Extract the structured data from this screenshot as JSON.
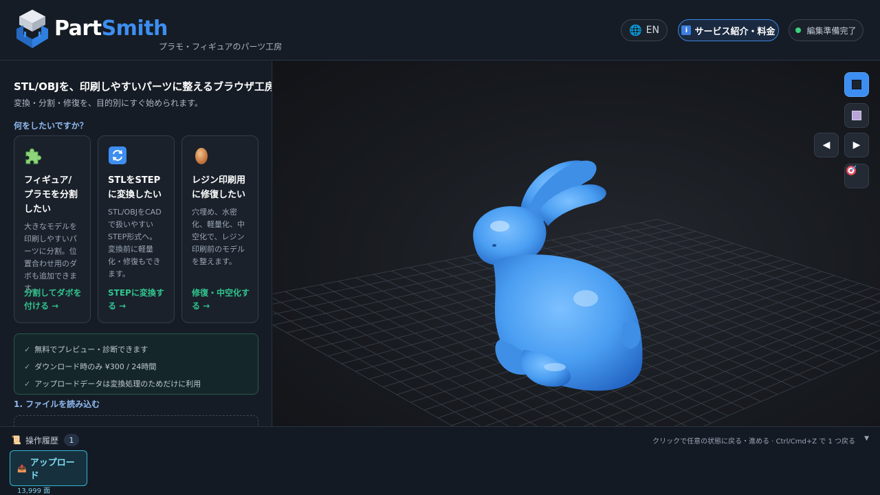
{
  "header": {
    "brand_part1": "Part",
    "brand_part2": "Smith",
    "tagline": "プラモ・フィギュアのパーツ工房",
    "lang_label": "EN",
    "service_label": "サービス紹介・料金",
    "status_label": "編集準備完了"
  },
  "panel": {
    "headline": "STL/OBJを、印刷しやすいパーツに整えるブラウザ工房。",
    "subline": "変換・分割・修復を、目的別にすぐ始められます。",
    "question": "何をしたいですか？",
    "cards": [
      {
        "icon": "puzzle-icon",
        "title": "フィギュア/プラモを分割したい",
        "desc": "大きなモデルを印刷しやすいパーツに分割。位置合わせ用のダボも追加できます。",
        "link": "分割してダボを付ける →"
      },
      {
        "icon": "convert-icon",
        "title": "STLをSTEPに変換したい",
        "desc": "STL/OBJをCADで扱いやすいSTEP形式へ。変換前に軽量化・修復もできます。",
        "link": "STEPに変換する →"
      },
      {
        "icon": "egg-icon",
        "title": "レジン印刷用に修復したい",
        "desc": "穴埋め、水密化、軽量化、中空化で、レジン印刷前のモデルを整えます。",
        "link": "修復・中空化する →"
      }
    ],
    "info": [
      "無料でプレビュー・診断できます",
      "ダウンロード時のみ ¥300 / 24時間",
      "アップロードデータは変換処理のためだけに利用"
    ],
    "step1": "1. ファイルを読み込む"
  },
  "viewport": {
    "tools": [
      "solid-view-icon",
      "wireframe-view-icon",
      "prev-arrow-icon",
      "next-arrow-icon",
      "target-icon"
    ]
  },
  "history": {
    "title": "操作履歴",
    "count": "1",
    "hint": "クリックで任意の状態に戻る・進める · Ctrl/Cmd+Z で 1 つ戻る",
    "items": [
      {
        "label": "アップロード",
        "meta": "13,999 面"
      }
    ]
  },
  "colors": {
    "accent_blue": "#3d8ef0",
    "link_green": "#31c48d",
    "model_blue": "#4a9ef2",
    "history_cyan": "#2fb8d6"
  }
}
